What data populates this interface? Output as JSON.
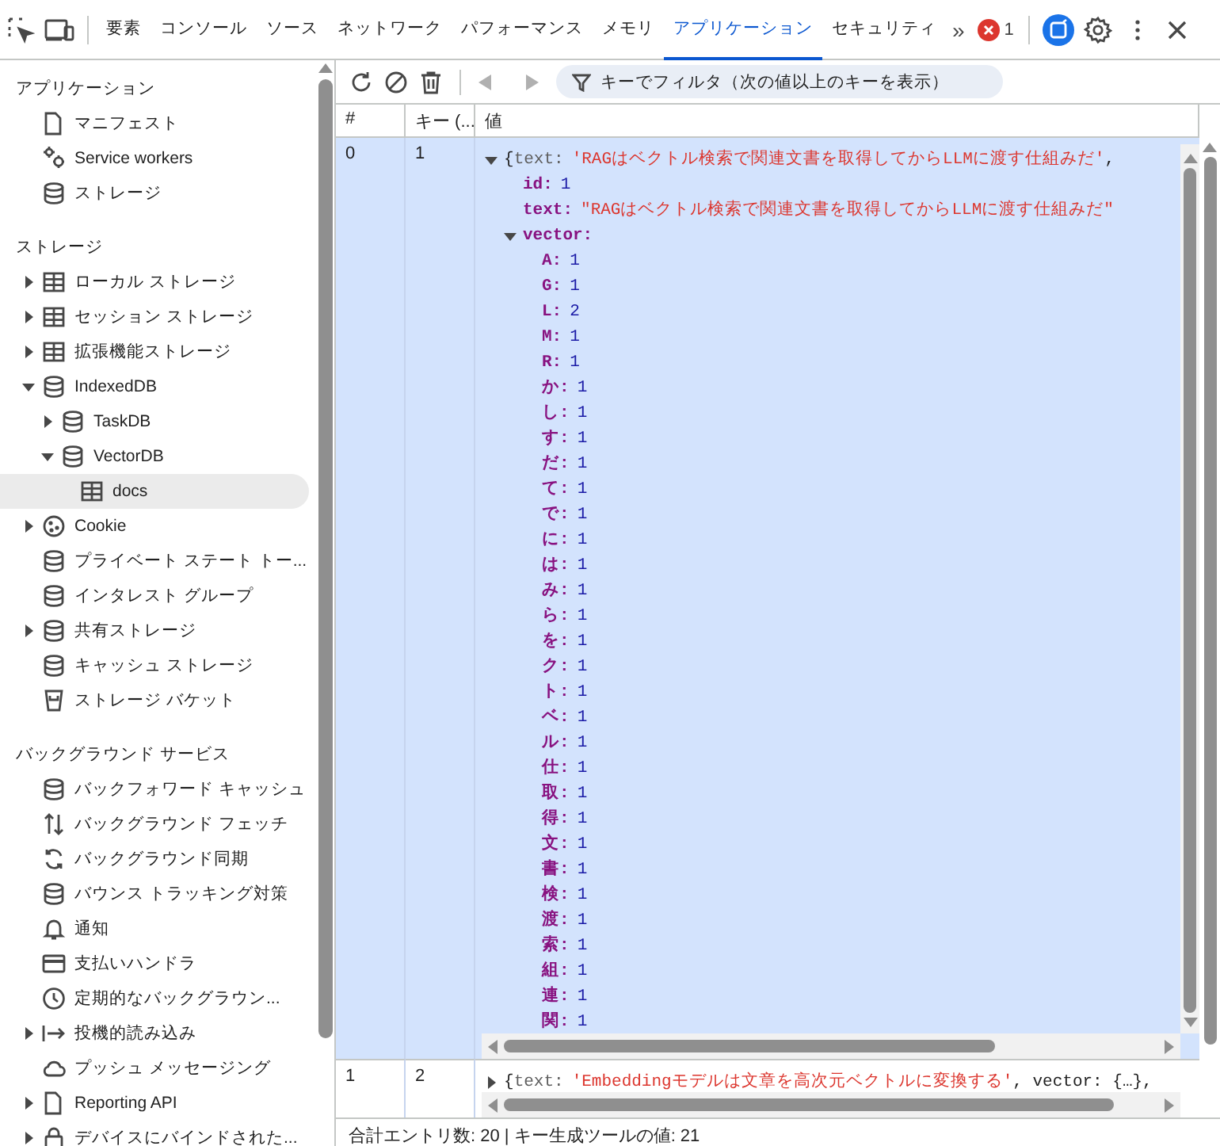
{
  "tabbar": {
    "tabs": [
      {
        "label": "要素",
        "selected": false
      },
      {
        "label": "コンソール",
        "selected": false
      },
      {
        "label": "ソース",
        "selected": false
      },
      {
        "label": "ネットワーク",
        "selected": false
      },
      {
        "label": "パフォーマンス",
        "selected": false
      },
      {
        "label": "メモリ",
        "selected": false
      },
      {
        "label": "アプリケーション",
        "selected": true
      },
      {
        "label": "セキュリティ",
        "selected": false
      }
    ],
    "more": "»",
    "error_count": "1"
  },
  "sidebar": {
    "sections": [
      {
        "title": "アプリケーション",
        "items": [
          {
            "label": "マニフェスト",
            "kind": "file",
            "selected": false
          },
          {
            "label": "Service workers",
            "kind": "gears",
            "selected": false
          },
          {
            "label": "ストレージ",
            "kind": "database",
            "selected": false
          }
        ]
      },
      {
        "title": "ストレージ",
        "items": [
          {
            "label": "ローカル ストレージ",
            "kind": "table",
            "expanded": false,
            "selected": false
          },
          {
            "label": "セッション ストレージ",
            "kind": "table",
            "expanded": false,
            "selected": false
          },
          {
            "label": "拡張機能ストレージ",
            "kind": "table",
            "expanded": false,
            "selected": false
          },
          {
            "label": "IndexedDB",
            "kind": "database",
            "expanded": true,
            "selected": false,
            "children": [
              {
                "label": "TaskDB",
                "kind": "database",
                "expanded": false,
                "selected": false
              },
              {
                "label": "VectorDB",
                "kind": "database",
                "expanded": true,
                "selected": false,
                "children": [
                  {
                    "label": "docs",
                    "kind": "table",
                    "selected": true
                  }
                ]
              }
            ]
          },
          {
            "label": "Cookie",
            "kind": "cookie",
            "expanded": false,
            "selected": false
          },
          {
            "label": "プライベート ステート トー...",
            "kind": "database",
            "selected": false
          },
          {
            "label": "インタレスト グループ",
            "kind": "database",
            "selected": false
          },
          {
            "label": "共有ストレージ",
            "kind": "database",
            "expanded": false,
            "selected": false
          },
          {
            "label": "キャッシュ ストレージ",
            "kind": "database",
            "selected": false
          },
          {
            "label": "ストレージ バケット",
            "kind": "bucket",
            "selected": false
          }
        ]
      },
      {
        "title": "バックグラウンド サービス",
        "items": [
          {
            "label": "バックフォワード キャッシュ",
            "kind": "database",
            "selected": false
          },
          {
            "label": "バックグラウンド フェッチ",
            "kind": "arrows",
            "selected": false
          },
          {
            "label": "バックグラウンド同期",
            "kind": "sync",
            "selected": false
          },
          {
            "label": "バウンス トラッキング対策",
            "kind": "database",
            "selected": false
          },
          {
            "label": "通知",
            "kind": "bell",
            "selected": false
          },
          {
            "label": "支払いハンドラ",
            "kind": "card",
            "selected": false
          },
          {
            "label": "定期的なバックグラウン...",
            "kind": "clock",
            "selected": false
          },
          {
            "label": "投機的読み込み",
            "kind": "prefetch",
            "expanded": false,
            "selected": false
          },
          {
            "label": "プッシュ メッセージング",
            "kind": "cloud",
            "selected": false
          },
          {
            "label": "Reporting API",
            "kind": "file",
            "expanded": false,
            "selected": false
          },
          {
            "label": "デバイスにバインドされた...",
            "kind": "lock",
            "expanded": false,
            "selected": false
          }
        ]
      }
    ]
  },
  "toolbar": {
    "filter": {
      "placeholder": "キーでフィルタ（次の値以上のキーを表示）"
    }
  },
  "table": {
    "columns": [
      "#",
      "キー (...",
      "値"
    ],
    "rows": [
      {
        "index": "0",
        "key": "1",
        "selected": true,
        "expanded": true,
        "preview": {
          "open": "{",
          "key": "text:",
          "value": "'RAGはベクトル検索で関連文書を取得してからLLMに渡す仕組みだ'",
          "tail": ","
        },
        "fields": [
          {
            "key": "id:",
            "value": "1",
            "kind": "number"
          },
          {
            "key": "text:",
            "value": "\"RAGはベクトル検索で関連文書を取得してからLLMに渡す仕組みだ\"",
            "kind": "string"
          }
        ],
        "vector": {
          "key": "vector:",
          "expanded": true,
          "entries": [
            {
              "key": "A:",
              "value": "1"
            },
            {
              "key": "G:",
              "value": "1"
            },
            {
              "key": "L:",
              "value": "2"
            },
            {
              "key": "M:",
              "value": "1"
            },
            {
              "key": "R:",
              "value": "1"
            },
            {
              "key": "か:",
              "value": "1"
            },
            {
              "key": "し:",
              "value": "1"
            },
            {
              "key": "す:",
              "value": "1"
            },
            {
              "key": "だ:",
              "value": "1"
            },
            {
              "key": "て:",
              "value": "1"
            },
            {
              "key": "で:",
              "value": "1"
            },
            {
              "key": "に:",
              "value": "1"
            },
            {
              "key": "は:",
              "value": "1"
            },
            {
              "key": "み:",
              "value": "1"
            },
            {
              "key": "ら:",
              "value": "1"
            },
            {
              "key": "を:",
              "value": "1"
            },
            {
              "key": "ク:",
              "value": "1"
            },
            {
              "key": "ト:",
              "value": "1"
            },
            {
              "key": "ベ:",
              "value": "1"
            },
            {
              "key": "ル:",
              "value": "1"
            },
            {
              "key": "仕:",
              "value": "1"
            },
            {
              "key": "取:",
              "value": "1"
            },
            {
              "key": "得:",
              "value": "1"
            },
            {
              "key": "文:",
              "value": "1"
            },
            {
              "key": "書:",
              "value": "1"
            },
            {
              "key": "検:",
              "value": "1"
            },
            {
              "key": "渡:",
              "value": "1"
            },
            {
              "key": "索:",
              "value": "1"
            },
            {
              "key": "組:",
              "value": "1"
            },
            {
              "key": "連:",
              "value": "1"
            },
            {
              "key": "関:",
              "value": "1"
            }
          ]
        }
      },
      {
        "index": "1",
        "key": "2",
        "selected": false,
        "expanded": false,
        "preview": {
          "open": "{",
          "key": "text:",
          "value": "'Embeddingモデルは文章を高次元ベクトルに変換する'",
          "tail": ", vector: {…},"
        }
      }
    ]
  },
  "status_bar": "合計エントリ数: 20 | キー生成ツールの値: 21"
}
